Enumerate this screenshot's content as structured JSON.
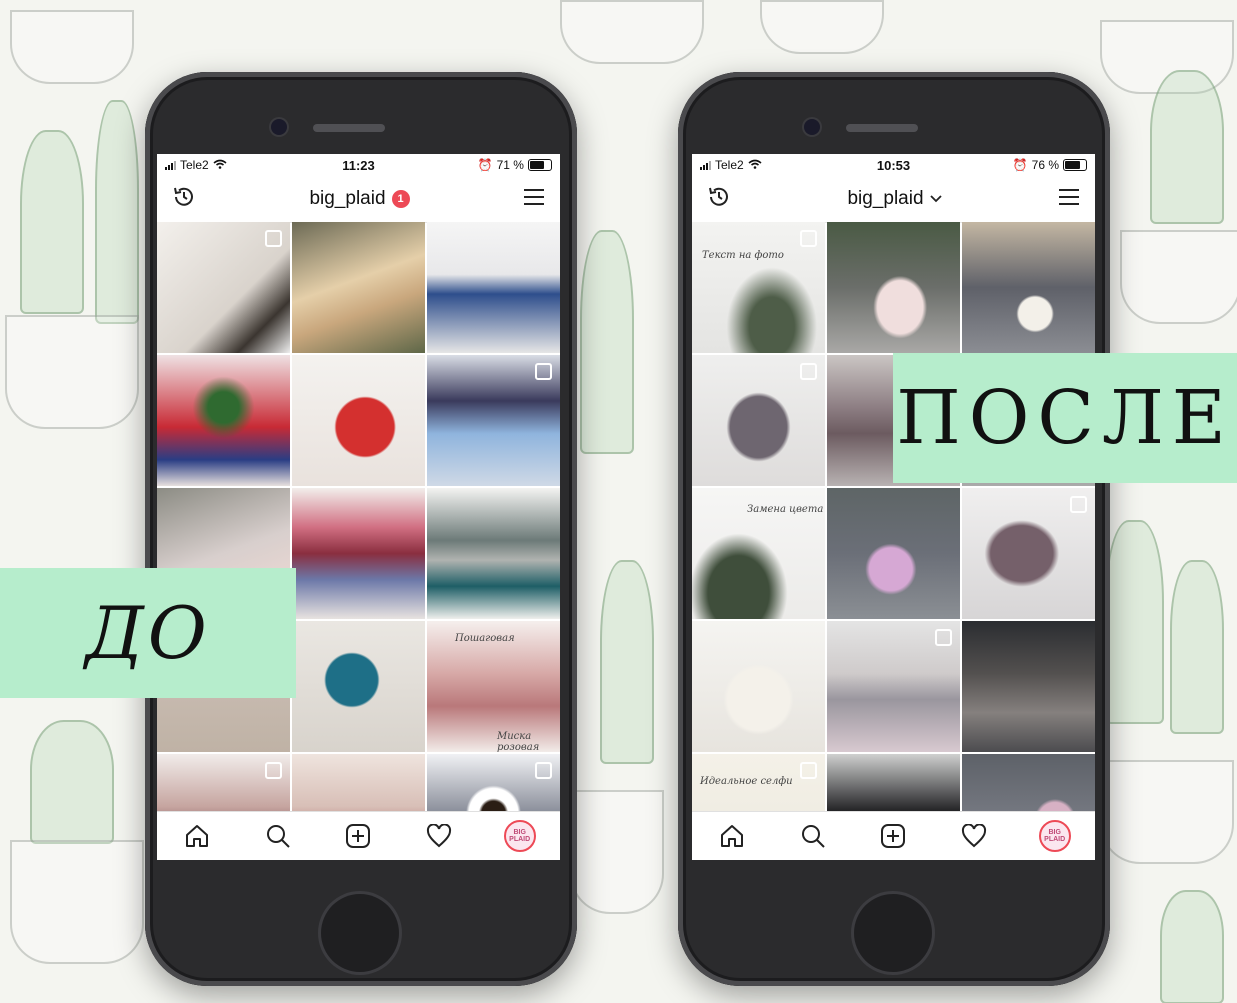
{
  "labels": {
    "before": "ДО",
    "after": "ПОСЛЕ"
  },
  "phones": [
    {
      "status": {
        "carrier": "Tele2",
        "time": "11:23",
        "battery": "71 %",
        "battery_level": 0.71
      },
      "header": {
        "username": "big_plaid",
        "notification_count": "1"
      },
      "grid_captions": {
        "t16": "Пошаговая",
        "t16b": "Миска розовая"
      },
      "avatar_text": "BIG PLAID"
    },
    {
      "status": {
        "carrier": "Tele2",
        "time": "10:53",
        "battery": "76 %",
        "battery_level": 0.76
      },
      "header": {
        "username": "big_plaid",
        "dropdown_icon": "chevron-down-icon"
      },
      "grid_captions": {
        "t1": "Текст на фото",
        "t7": "Замена цвета",
        "t16": "Идеальное селфи"
      },
      "avatar_text": "BIG PLAID"
    }
  ],
  "icons": [
    "history-icon",
    "menu-icon",
    "home-icon",
    "search-icon",
    "add-post-icon",
    "heart-icon"
  ],
  "colors": {
    "label_bg": "#b6edcc",
    "badge": "#ed4956"
  }
}
